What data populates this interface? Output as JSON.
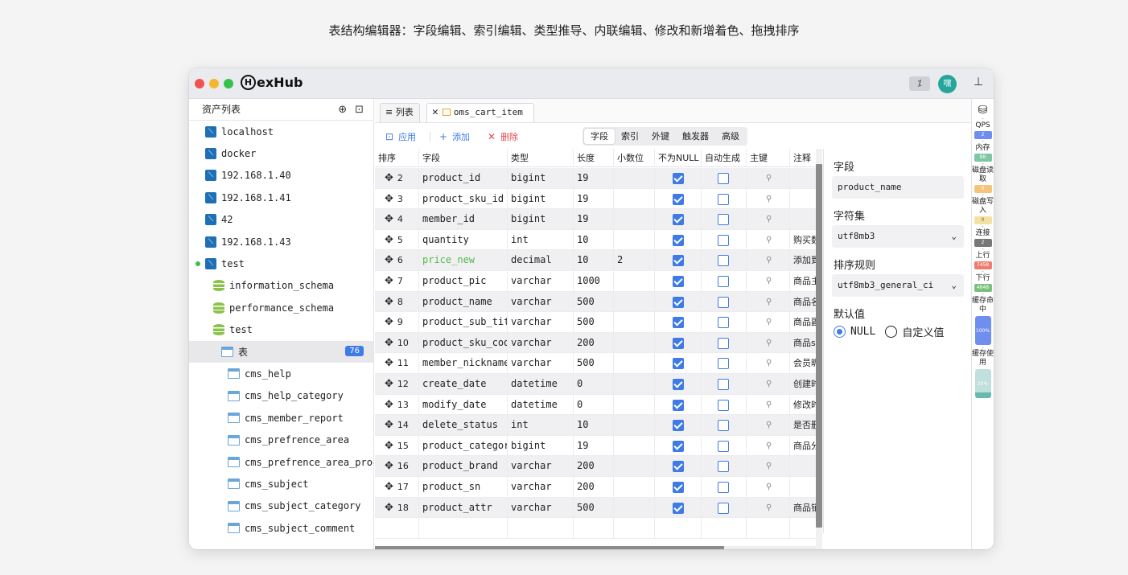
{
  "caption": "表结构编辑器：字段编辑、索引编辑、类型推导、内联编辑、修改和新增着色、拖拽排序",
  "app": {
    "logo_mark": "H",
    "name": "exHub",
    "avatar_text": "嘿"
  },
  "sidebar": {
    "title": "资产列表",
    "items": [
      {
        "label": "localhost"
      },
      {
        "label": "docker"
      },
      {
        "label": "192.168.1.40"
      },
      {
        "label": "192.168.1.41"
      },
      {
        "label": "42"
      },
      {
        "label": "192.168.1.43"
      },
      {
        "label": "test"
      },
      {
        "label": "information_schema"
      },
      {
        "label": "performance_schema"
      },
      {
        "label": "test"
      },
      {
        "label": "表",
        "count": "76"
      },
      {
        "label": "cms_help"
      },
      {
        "label": "cms_help_category"
      },
      {
        "label": "cms_member_report"
      },
      {
        "label": "cms_prefrence_area"
      },
      {
        "label": "cms_prefrence_area_product_relation"
      },
      {
        "label": "cms_subject"
      },
      {
        "label": "cms_subject_category"
      },
      {
        "label": "cms_subject_comment"
      }
    ]
  },
  "tabs": {
    "list_label": "列表",
    "table_label": "oms_cart_item"
  },
  "toolbar": {
    "apply": "应用",
    "add": "添加",
    "delete": "删除",
    "segments": [
      "字段",
      "索引",
      "外键",
      "触发器",
      "高级"
    ],
    "active_segment": "字段"
  },
  "grid": {
    "headers": [
      "排序",
      "字段",
      "类型",
      "长度",
      "小数位",
      "不为NULL",
      "自动生成",
      "主键",
      "注释"
    ],
    "rows": [
      {
        "n": "2",
        "field": "product_id",
        "type": "bigint",
        "len": "19",
        "dec": "",
        "comment": ""
      },
      {
        "n": "3",
        "field": "product_sku_id",
        "type": "bigint",
        "len": "19",
        "dec": "",
        "comment": ""
      },
      {
        "n": "4",
        "field": "member_id",
        "type": "bigint",
        "len": "19",
        "dec": "",
        "comment": ""
      },
      {
        "n": "5",
        "field": "quantity",
        "type": "int",
        "len": "10",
        "dec": "",
        "comment": "购买数"
      },
      {
        "n": "6",
        "field": "price_new",
        "type": "decimal",
        "len": "10",
        "dec": "2",
        "comment": "添加到"
      },
      {
        "n": "7",
        "field": "product_pic",
        "type": "varchar",
        "len": "1000",
        "dec": "",
        "comment": "商品主"
      },
      {
        "n": "8",
        "field": "product_name",
        "type": "varchar",
        "len": "500",
        "dec": "",
        "comment": "商品名"
      },
      {
        "n": "9",
        "field": "product_sub_title",
        "type": "varchar",
        "len": "500",
        "dec": "",
        "comment": "商品副"
      },
      {
        "n": "10",
        "field": "product_sku_code",
        "type": "varchar",
        "len": "200",
        "dec": "",
        "comment": "商品s"
      },
      {
        "n": "11",
        "field": "member_nickname",
        "type": "varchar",
        "len": "500",
        "dec": "",
        "comment": "会员昵"
      },
      {
        "n": "12",
        "field": "create_date",
        "type": "datetime",
        "len": "0",
        "dec": "",
        "comment": "创建时"
      },
      {
        "n": "13",
        "field": "modify_date",
        "type": "datetime",
        "len": "0",
        "dec": "",
        "comment": "修改时"
      },
      {
        "n": "14",
        "field": "delete_status",
        "type": "int",
        "len": "10",
        "dec": "",
        "comment": "是否删"
      },
      {
        "n": "15",
        "field": "product_category_id",
        "type": "bigint",
        "len": "19",
        "dec": "",
        "comment": "商品分"
      },
      {
        "n": "16",
        "field": "product_brand",
        "type": "varchar",
        "len": "200",
        "dec": "",
        "comment": ""
      },
      {
        "n": "17",
        "field": "product_sn",
        "type": "varchar",
        "len": "200",
        "dec": "",
        "comment": ""
      },
      {
        "n": "18",
        "field": "product_attr",
        "type": "varchar",
        "len": "500",
        "dec": "",
        "comment": "商品销"
      }
    ]
  },
  "props": {
    "field_label": "字段",
    "field_value": "product_name",
    "charset_label": "字符集",
    "charset_value": "utf8mb3",
    "collation_label": "排序规则",
    "collation_value": "utf8mb3_general_ci",
    "default_label": "默认值",
    "default_null": "NULL",
    "default_custom": "自定义值"
  },
  "metrics": {
    "qps_label": "QPS",
    "qps_value": "2",
    "mem_label": "内存",
    "mem_value": "88",
    "disk_read_label": "磁盘读取",
    "disk_read_value": "0",
    "disk_write_label": "磁盘写入",
    "disk_write_value": "0",
    "conn_label": "连接",
    "conn_value": "2",
    "up_label": "上行",
    "up_value": "7458",
    "down_label": "下行",
    "down_value": "4648",
    "cache_hit_label": "缓存命中",
    "cache_hit_value": "100%",
    "cache_use_label": "缓存使用",
    "cache_use_value": "20%"
  },
  "colors": {
    "accent": "#3f7be6",
    "danger": "#e24b4b",
    "new_field": "#55b84a"
  }
}
